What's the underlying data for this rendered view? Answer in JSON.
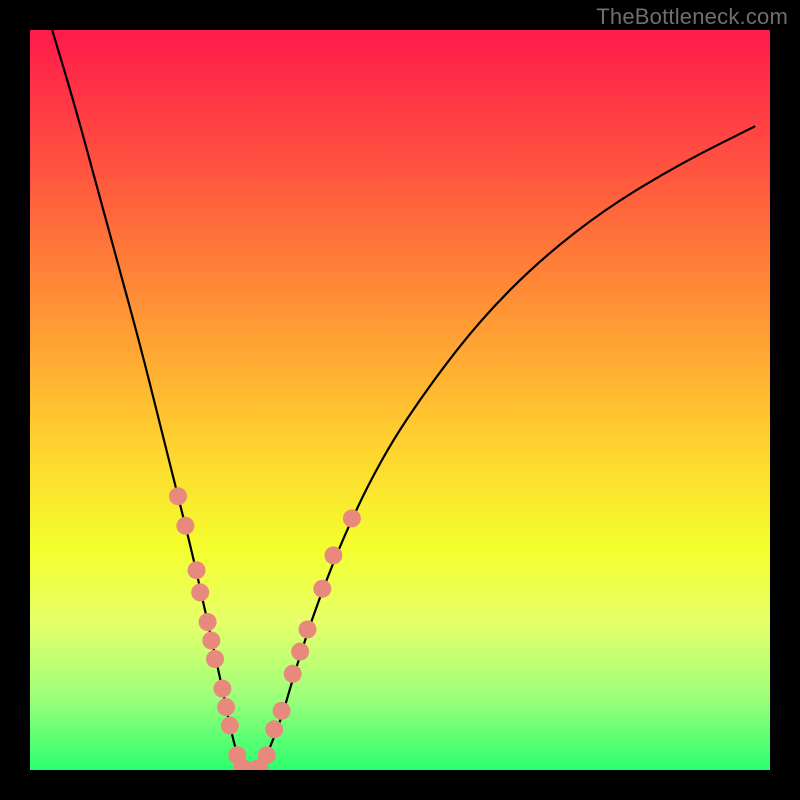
{
  "watermark": "TheBottleneck.com",
  "chart_data": {
    "type": "line",
    "title": "",
    "xlabel": "",
    "ylabel": "",
    "xlim": [
      0,
      100
    ],
    "ylim": [
      0,
      100
    ],
    "grid": false,
    "legend": false,
    "curve": {
      "name": "bottleneck-v-curve",
      "note": "V-shaped bottleneck curve; y is visual height percentage (0 = bottom/green, 100 = top/red). Values estimated from pixel positions against the 740px plot area.",
      "x": [
        3,
        6,
        9,
        12,
        15,
        18,
        20,
        22,
        24,
        26,
        27,
        28,
        29,
        30,
        31,
        32,
        34,
        36,
        39,
        43,
        48,
        54,
        61,
        69,
        78,
        88,
        98
      ],
      "y": [
        100,
        90,
        79,
        68,
        57,
        45,
        37,
        29,
        20,
        11,
        6,
        2,
        0,
        0,
        0,
        2,
        7,
        14,
        23,
        33,
        43,
        52,
        61,
        69,
        76,
        82,
        87
      ]
    },
    "markers": {
      "name": "salmon-dot-markers",
      "color": "#e78a7d",
      "note": "Salmon-colored dots clustered on the two arms of the V near the trough; positions estimated from pixels.",
      "points": [
        {
          "x": 20.0,
          "y": 37.0
        },
        {
          "x": 21.0,
          "y": 33.0
        },
        {
          "x": 22.5,
          "y": 27.0
        },
        {
          "x": 23.0,
          "y": 24.0
        },
        {
          "x": 24.0,
          "y": 20.0
        },
        {
          "x": 24.5,
          "y": 17.5
        },
        {
          "x": 25.0,
          "y": 15.0
        },
        {
          "x": 26.0,
          "y": 11.0
        },
        {
          "x": 26.5,
          "y": 8.5
        },
        {
          "x": 27.0,
          "y": 6.0
        },
        {
          "x": 28.0,
          "y": 2.0
        },
        {
          "x": 28.7,
          "y": 0.3
        },
        {
          "x": 29.5,
          "y": 0.0
        },
        {
          "x": 30.3,
          "y": 0.0
        },
        {
          "x": 31.0,
          "y": 0.3
        },
        {
          "x": 32.0,
          "y": 2.0
        },
        {
          "x": 33.0,
          "y": 5.5
        },
        {
          "x": 34.0,
          "y": 8.0
        },
        {
          "x": 35.5,
          "y": 13.0
        },
        {
          "x": 36.5,
          "y": 16.0
        },
        {
          "x": 37.5,
          "y": 19.0
        },
        {
          "x": 39.5,
          "y": 24.5
        },
        {
          "x": 41.0,
          "y": 29.0
        },
        {
          "x": 43.5,
          "y": 34.0
        }
      ]
    },
    "gradient_stops": [
      {
        "offset": 0.0,
        "color": "#ff1a4b"
      },
      {
        "offset": 0.18,
        "color": "#ff5140"
      },
      {
        "offset": 0.36,
        "color": "#ff8d36"
      },
      {
        "offset": 0.56,
        "color": "#ffd22f"
      },
      {
        "offset": 0.7,
        "color": "#f4ff2e"
      },
      {
        "offset": 0.8,
        "color": "#e6ff6a"
      },
      {
        "offset": 0.9,
        "color": "#9fff7a"
      },
      {
        "offset": 1.0,
        "color": "#2bff6e"
      }
    ]
  }
}
